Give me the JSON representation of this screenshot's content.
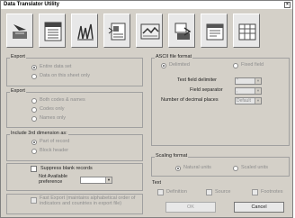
{
  "window": {
    "title": "Data Translator Utility",
    "close": "×"
  },
  "toolbar": {
    "buttons": [
      {
        "icon": "tool-arrow-icon"
      },
      {
        "icon": "tool-document-icon"
      },
      {
        "icon": "tool-chart-icon"
      },
      {
        "icon": "tool-page-icon"
      },
      {
        "icon": "tool-map-icon"
      },
      {
        "icon": "tool-export-icon"
      },
      {
        "icon": "tool-notepad-icon"
      },
      {
        "icon": "tool-table-icon"
      }
    ]
  },
  "export_scope": {
    "label": "Export",
    "options": [
      {
        "label": "Entire data set",
        "selected": true
      },
      {
        "label": "Data on this sheet only",
        "selected": false
      }
    ]
  },
  "export_codes": {
    "label": "Export",
    "options": [
      {
        "label": "Both codes & names",
        "selected": false
      },
      {
        "label": "Codes only",
        "selected": false
      },
      {
        "label": "Names only",
        "selected": false
      }
    ]
  },
  "third_dimension": {
    "label": "Include 3rd dimension as:",
    "options": [
      {
        "label": "Part of record",
        "selected": true
      },
      {
        "label": "Block header",
        "selected": false
      }
    ]
  },
  "blank_records": {
    "suppress_label": "Suppress blank records",
    "not_available_label": "Not Available\npreference",
    "not_available_value": ""
  },
  "fast_export": {
    "label": "Fast Export (maintains alphabetical order of indicators and countries in export file)"
  },
  "ascii_format": {
    "label": "ASCII file format",
    "options": [
      {
        "label": "Delimited",
        "selected": true
      },
      {
        "label": "Fixed field",
        "selected": false
      }
    ],
    "text_field_delimiter": {
      "label": "Text field delimiter",
      "value": "\""
    },
    "field_separator": {
      "label": "Field separator",
      "value": ","
    },
    "decimal_places": {
      "label": "Number of decimal places",
      "value": "Default"
    }
  },
  "scaling_format": {
    "label": "Scaling format",
    "options": [
      {
        "label": "Natural units",
        "selected": true
      },
      {
        "label": "Scaled units",
        "selected": false
      }
    ]
  },
  "text_section": {
    "label": "Text",
    "options": [
      {
        "label": "Definition"
      },
      {
        "label": "Source"
      },
      {
        "label": "Footnotes"
      }
    ]
  },
  "buttons": {
    "ok": "OK",
    "cancel": "Cancel"
  }
}
